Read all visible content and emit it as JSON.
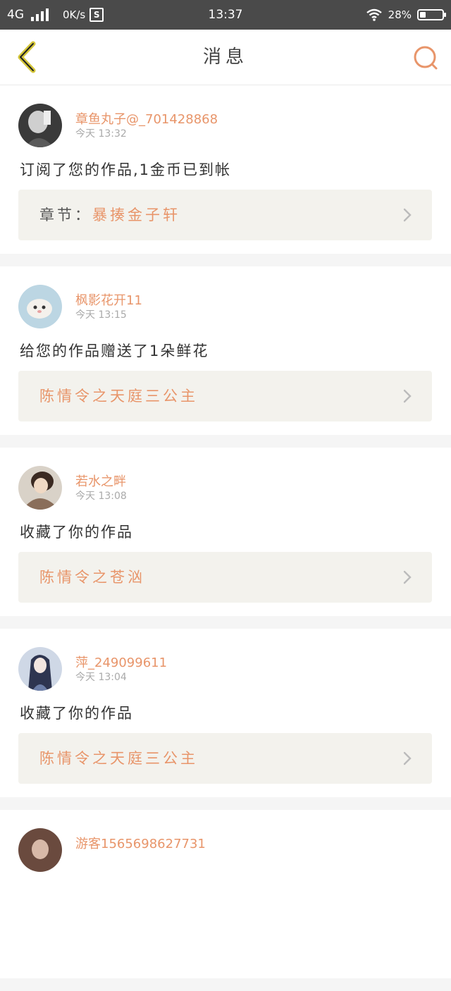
{
  "status_bar": {
    "network": "4G",
    "speed": "0K/s",
    "s_badge": "S",
    "time": "13:37",
    "battery": "28%",
    "battery_level": 0.28
  },
  "nav": {
    "title": "消息",
    "back_icon": "chevron-left-icon",
    "search_icon": "search-icon"
  },
  "colors": {
    "accent": "#e8956a",
    "status_bar_bg": "#4a4a4a",
    "work_box_bg": "#f3f2ed"
  },
  "messages": [
    {
      "username": "章鱼丸子@_701428868",
      "time": "今天 13:32",
      "text": "订阅了您的作品,1金币已到帐",
      "work_prefix": "章节：",
      "work_title": "暴揍金子轩"
    },
    {
      "username": "枫影花开11",
      "time": "今天 13:15",
      "text": "给您的作品赠送了1朵鲜花",
      "work_prefix": "",
      "work_title": "陈情令之天庭三公主"
    },
    {
      "username": "若水之畔",
      "time": "今天 13:08",
      "text": "收藏了你的作品",
      "work_prefix": "",
      "work_title": "陈情令之苍汹"
    },
    {
      "username": "萍_249099611",
      "time": "今天 13:04",
      "text": "收藏了你的作品",
      "work_prefix": "",
      "work_title": "陈情令之天庭三公主"
    },
    {
      "username": "游客1565698627731",
      "time": "",
      "text": "",
      "work_prefix": "",
      "work_title": ""
    }
  ]
}
